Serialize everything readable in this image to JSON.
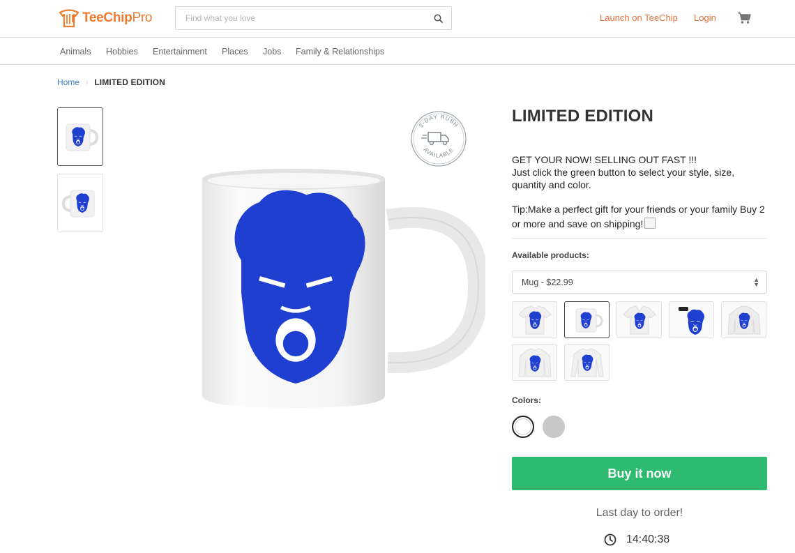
{
  "header": {
    "logo_main": "TeeChip",
    "logo_sub": "Pro",
    "search_placeholder": "Find what you love",
    "launch_link": "Launch on TeeChip",
    "login_link": "Login"
  },
  "nav": {
    "categories": [
      "Animals",
      "Hobbies",
      "Entertainment",
      "Places",
      "Jobs",
      "Family & Relationships"
    ]
  },
  "breadcrumb": {
    "home": "Home",
    "separator": "›",
    "current": "LIMITED EDITION"
  },
  "badge": {
    "top_text": "3-DAY RUSH",
    "bottom_text": "AVAILABLE"
  },
  "product": {
    "title": "LIMITED EDITION",
    "description_line1": "GET YOUR NOW! SELLING OUT FAST !!!",
    "description_line2": "Just click the green button to select your style, size, quantity and color.",
    "tip": "Tip:Make a perfect gift for your friends or your family Buy 2 or more and save on shipping!",
    "available_label": "Available products:",
    "selected_product": "Mug - $22.99",
    "colors_label": "Colors:",
    "buy_label": "Buy it now",
    "last_day": "Last day to order!",
    "timer": "14:40:38"
  },
  "colors": {
    "accent": "#f07a2d",
    "link": "#3a7cc2",
    "buy_button": "#2ebb71",
    "print": "#1f3fd1"
  },
  "icons": [
    "search-icon",
    "cart-icon",
    "clock-icon",
    "truck-icon"
  ]
}
